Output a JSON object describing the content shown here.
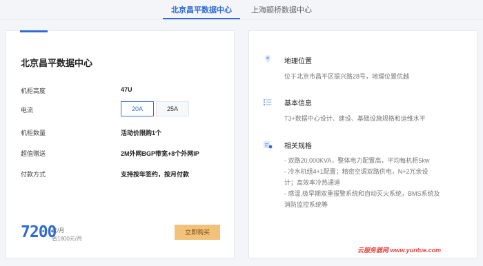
{
  "tabs": [
    {
      "label": "北京昌平数据中心",
      "active": true
    },
    {
      "label": "上海颛桥数据中心",
      "active": false
    }
  ],
  "product": {
    "title": "北京昌平数据中心",
    "specs": {
      "cabinet_height": {
        "label": "机柜高度",
        "value": "47U"
      },
      "power": {
        "label": "电流",
        "options": [
          "20A",
          "25A"
        ],
        "selected": "20A"
      },
      "cabinet_count": {
        "label": "机柜数量",
        "value": "活动价限购1个"
      },
      "bonus": {
        "label": "超值赠送",
        "value": "2M外网BGP带宽+8个外网IP"
      },
      "payment": {
        "label": "付款方式",
        "value": "支持按年签约，按月付款"
      }
    },
    "price": {
      "amount": "7200",
      "unit": "元/月",
      "save": "省1800元/月"
    },
    "buy_label": "立即购买"
  },
  "info": {
    "location": {
      "title": "地理位置",
      "text": "位于北京市昌平区振兴路28号，地理位置优越",
      "icon": "location-pin-icon"
    },
    "basic": {
      "title": "基本信息",
      "text": "T3+数据中心设计、建设、基础设施规格和运维水平",
      "icon": "list-icon"
    },
    "specs": {
      "title": "相关规格",
      "icon": "spec-icon",
      "lines": [
        "- 双路20,000KVA，整体电力配置高，平均每机柜5kw",
        "- 冷水机组4+1配置；精密空调双路供电，N+2冗余设",
        "计；高效率冷热通道",
        "- 感温,极早期双重报警系统和自动灭火系统，BMS系统及",
        "消防监控系统等"
      ]
    }
  },
  "watermark": "云服务器网 www.yuntue.com",
  "colors": {
    "accent": "#2f6bd8",
    "buy": "#f2c27a",
    "bg": "#f3f5f8"
  }
}
